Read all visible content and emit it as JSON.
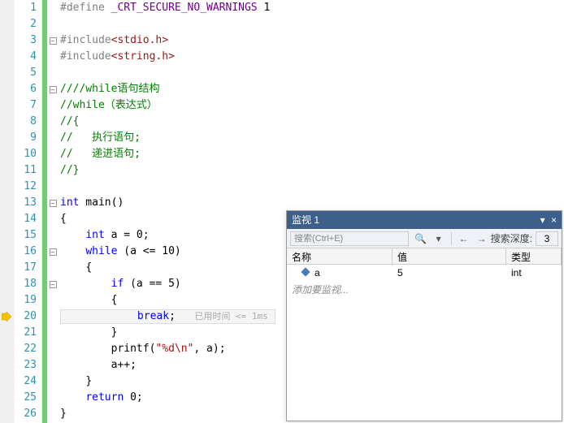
{
  "lines": {
    "l1_define": "#define",
    "l1_macro": "_CRT_SECURE_NO_WARNINGS",
    "l1_val": "1",
    "l3_inc": "#include",
    "l3_hdr": "<stdio.h>",
    "l4_inc": "#include",
    "l4_hdr": "<string.h>",
    "l6": "////while语句结构",
    "l7": "//while（表达式）",
    "l8": "//{",
    "l9": "//   执行语句;",
    "l10": "//   递进语句;",
    "l11": "//}",
    "l13_int": "int",
    "l13_main": " main()",
    "l14": "{",
    "l15_int": "int",
    "l15_rest": " a = 0;",
    "l16_while": "while",
    "l16_rest": " (a <= 10)",
    "l17": "{",
    "l18_if": "if",
    "l18_rest": " (a == 5)",
    "l19": "{",
    "l20_break": "break",
    "l20_semi": ";",
    "l20_time": "已用时间 <= 1ms",
    "l21": "}",
    "l22_printf": "printf(",
    "l22_fmt": "\"%d\\n\"",
    "l22_rest": ", a);",
    "l23": "a++;",
    "l24": "}",
    "l25_return": "return",
    "l25_rest": " 0;",
    "l26": "}"
  },
  "line_numbers": [
    "1",
    "2",
    "3",
    "4",
    "5",
    "6",
    "7",
    "8",
    "9",
    "10",
    "11",
    "12",
    "13",
    "14",
    "15",
    "16",
    "17",
    "18",
    "19",
    "20",
    "21",
    "22",
    "23",
    "24",
    "25",
    "26"
  ],
  "watch": {
    "title": "监视 1",
    "search_placeholder": "搜索(Ctrl+E)",
    "depth_label": "搜索深度:",
    "depth_value": "3",
    "col_name": "名称",
    "col_val": "值",
    "col_type": "类型",
    "row_name": "a",
    "row_val": "5",
    "row_type": "int",
    "add_text": "添加要监视..."
  }
}
